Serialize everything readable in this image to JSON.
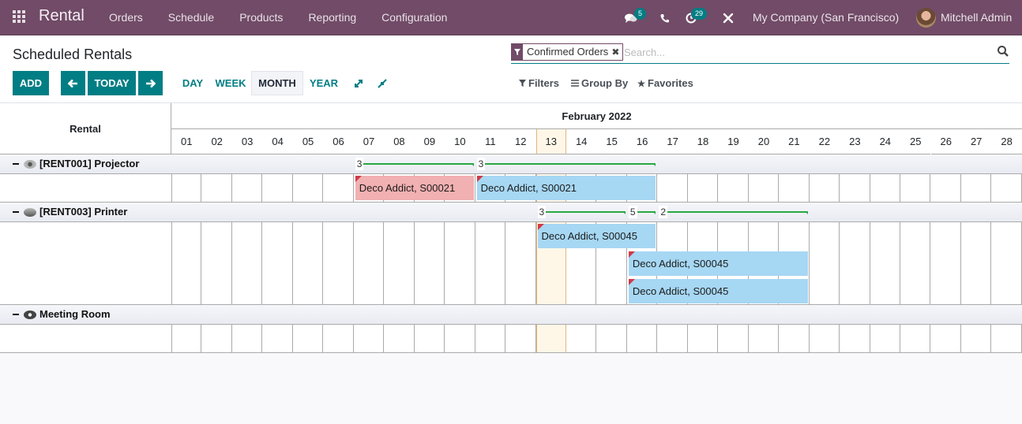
{
  "navbar": {
    "app_name": "Rental",
    "menu": [
      "Orders",
      "Schedule",
      "Products",
      "Reporting",
      "Configuration"
    ],
    "messages_badge": "5",
    "activities_badge": "29",
    "company": "My Company (San Francisco)",
    "user": "Mitchell Admin"
  },
  "control": {
    "title": "Scheduled Rentals",
    "add_label": "ADD",
    "today_label": "TODAY",
    "scales": [
      "DAY",
      "WEEK",
      "MONTH",
      "YEAR"
    ],
    "active_scale": "MONTH",
    "search": {
      "facet": "Confirmed Orders",
      "placeholder": "Search..."
    },
    "filters_label": "Filters",
    "groupby_label": "Group By",
    "favorites_label": "Favorites"
  },
  "gantt": {
    "row_header": "Rental",
    "month": "February 2022",
    "today": "13",
    "days": [
      "01",
      "02",
      "03",
      "04",
      "05",
      "06",
      "07",
      "08",
      "09",
      "10",
      "11",
      "12",
      "13",
      "14",
      "15",
      "16",
      "17",
      "18",
      "19",
      "20",
      "21",
      "22",
      "23",
      "24",
      "25",
      "26",
      "27",
      "28"
    ],
    "groups": [
      {
        "name": "[RENT001] Projector",
        "aggregates": [
          {
            "value": "3",
            "start": 7,
            "end": 10
          },
          {
            "value": "3",
            "start": 11,
            "end": 16
          }
        ],
        "pills": [
          {
            "label": "Deco Addict, S00021",
            "start": 7,
            "end": 10,
            "color": "pink",
            "lane": 0
          },
          {
            "label": "Deco Addict, S00021",
            "start": 11,
            "end": 16,
            "color": "blue",
            "lane": 0
          }
        ],
        "lanes": 1
      },
      {
        "name": "[RENT003] Printer",
        "aggregates": [
          {
            "value": "3",
            "start": 13,
            "end": 15
          },
          {
            "value": "5",
            "start": 16,
            "end": 16
          },
          {
            "value": "2",
            "start": 17,
            "end": 21
          }
        ],
        "pills": [
          {
            "label": "Deco Addict, S00045",
            "start": 13,
            "end": 16,
            "color": "blue",
            "lane": 0
          },
          {
            "label": "Deco Addict, S00045",
            "start": 16,
            "end": 21,
            "color": "blue",
            "lane": 1
          },
          {
            "label": "Deco Addict, S00045",
            "start": 16,
            "end": 21,
            "color": "blue",
            "lane": 2
          }
        ],
        "lanes": 3
      },
      {
        "name": "Meeting Room",
        "aggregates": [],
        "pills": [],
        "lanes": 1
      }
    ]
  }
}
